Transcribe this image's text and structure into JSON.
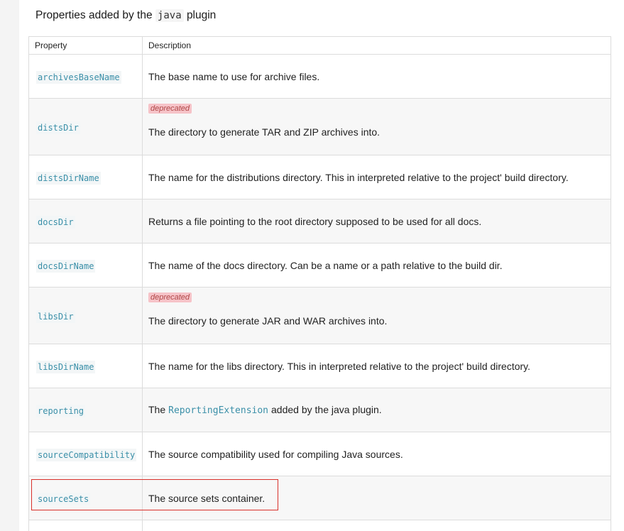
{
  "section": {
    "title_prefix": "Properties added by the",
    "title_code": "java",
    "title_suffix": "plugin"
  },
  "table": {
    "headers": [
      "Property",
      "Description"
    ],
    "rows": [
      {
        "property": "archivesBaseName",
        "description": "The base name to use for archive files.",
        "deprecated": false
      },
      {
        "property": "distsDir",
        "description": "The directory to generate TAR and ZIP archives into.",
        "deprecated": true,
        "badge": "deprecated"
      },
      {
        "property": "distsDirName",
        "description": "The name for the distributions directory. This in interpreted relative to the project' build directory.",
        "deprecated": false
      },
      {
        "property": "docsDir",
        "description": "Returns a file pointing to the root directory supposed to be used for all docs.",
        "deprecated": false
      },
      {
        "property": "docsDirName",
        "description": "The name of the docs directory. Can be a name or a path relative to the build dir.",
        "deprecated": false
      },
      {
        "property": "libsDir",
        "description": "The directory to generate JAR and WAR archives into.",
        "deprecated": true,
        "badge": "deprecated"
      },
      {
        "property": "libsDirName",
        "description": "The name for the libs directory. This in interpreted relative to the project' build directory.",
        "deprecated": false
      },
      {
        "property": "reporting",
        "description_prefix": "The",
        "description_code": "ReportingExtension",
        "description_suffix": "added by the java plugin.",
        "deprecated": false
      },
      {
        "property": "sourceCompatibility",
        "description": "The source compatibility used for compiling Java sources.",
        "deprecated": false
      },
      {
        "property": "sourceSets",
        "description": "The source sets container.",
        "deprecated": false
      }
    ]
  },
  "colors": {
    "highlight_border": "#d9302a",
    "property_code": "#3a8fa8",
    "deprecated_badge_bg": "#f6c3c8"
  }
}
